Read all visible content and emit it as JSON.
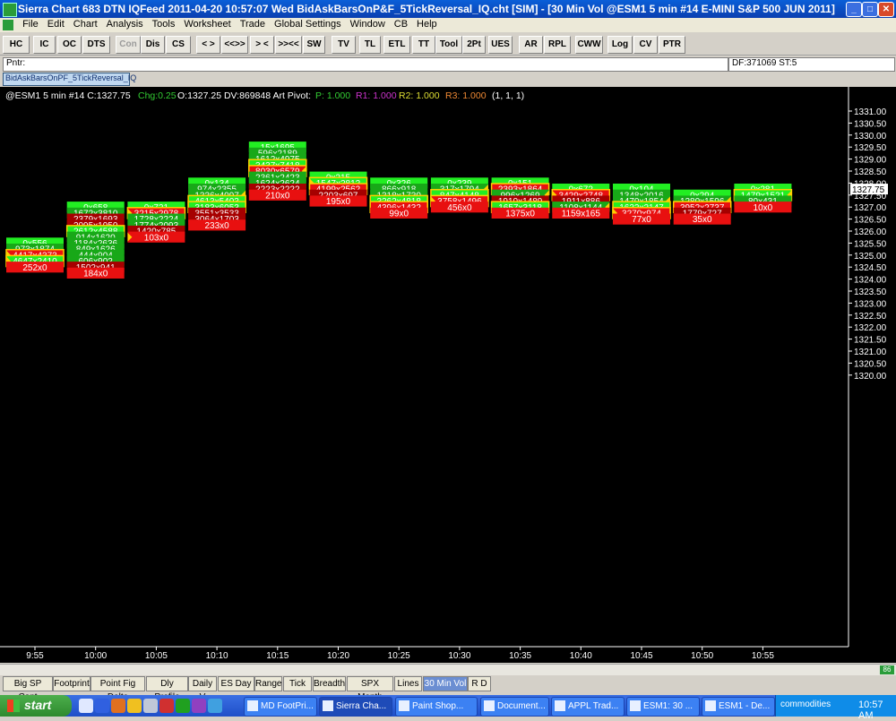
{
  "window": {
    "title": "Sierra Chart 683 DTN IQFeed 2011-04-20  10:57:07  Wed   BidAskBarsOnP&F_5TickReversal_IQ.cht [SIM] - [30 Min Vol  @ESM1  5 min   #14  E-MINI S&P 500 JUN 2011]"
  },
  "menu": [
    "File",
    "Edit",
    "Chart",
    "Analysis",
    "Tools",
    "Worksheet",
    "Trade",
    "Global Settings",
    "Window",
    "CB",
    "Help"
  ],
  "toolbar": [
    "HC",
    "IC",
    "OC",
    "DTS",
    "Con",
    "Dis",
    "CS",
    "< >",
    "<<>>",
    "> <",
    ">><<",
    "SW",
    "TV",
    "TL",
    "ETL",
    "TT",
    "Tool",
    "2Pt",
    "UES",
    "AR",
    "RPL",
    "CWW",
    "Log",
    "CV",
    "PTR"
  ],
  "pointer": {
    "label": "Pntr:",
    "df": "DF:371069  ST:5"
  },
  "study_name": "BidAskBarsOnPF_5TickReversal_IQ",
  "header": {
    "symbol": "@ESM1  5 min   #14 C:1327.75",
    "chg": "Chg:0.25",
    "info": "O:1327.25 DV:869848  Art Pivot:",
    "p": "P: 1.000",
    "r1": "R1: 1.000",
    "r2": "R2: 1.000",
    "r3": "R3: 1.000",
    "tail": "(1, 1, 1)"
  },
  "colors": {
    "green_bright": "#22ee22",
    "green": "#18a818",
    "red": "#e81010",
    "red_dark": "#a60000",
    "orange": "#ffa020",
    "chg": "#33cc33",
    "p": "#33cc33",
    "r1": "#cc33cc",
    "r2": "#dddd33",
    "r3": "#ee8833"
  },
  "chart_data": {
    "type": "table",
    "price_axis": {
      "min": 1320.0,
      "max": 1331.0,
      "step": 0.25,
      "labels_step": 0.5
    },
    "last_price": "1327.75",
    "time_labels": [
      "9:55",
      "10:00",
      "10:05",
      "10:10",
      "10:15",
      "10:20",
      "10:25",
      "10:30",
      "10:35",
      "10:40",
      "10:45",
      "10:50",
      "10:55"
    ],
    "bars": [
      {
        "time": "9:55",
        "top": 1325.5,
        "rows": [
          {
            "t": "0x556",
            "c": "gb"
          },
          {
            "t": "973x1874",
            "c": "g"
          },
          {
            "t": "4417x4373",
            "c": "ro",
            "m": "L"
          },
          {
            "t": "4647x2410",
            "c": "go",
            "m": "L"
          },
          {
            "t": "252x0",
            "c": "r"
          }
        ]
      },
      {
        "time": "10:00",
        "top": 1327.0,
        "rows": [
          {
            "t": "0x658",
            "c": "gb"
          },
          {
            "t": "1672x3810",
            "c": "g"
          },
          {
            "t": "2379x1693",
            "c": "rd"
          },
          {
            "t": "2095x1950",
            "c": "rd"
          },
          {
            "t": "2612x4588",
            "c": "go"
          },
          {
            "t": "914x1620",
            "c": "g"
          },
          {
            "t": "1184x2636",
            "c": "g"
          },
          {
            "t": "849x1626",
            "c": "g"
          },
          {
            "t": "444x904",
            "c": "g"
          },
          {
            "t": "606x902",
            "c": "g"
          },
          {
            "t": "1502x941",
            "c": "rd"
          },
          {
            "t": "184x0",
            "c": "r"
          }
        ]
      },
      {
        "time": "10:05",
        "top": 1327.0,
        "rows": [
          {
            "t": "0x721",
            "c": "gb"
          },
          {
            "t": "3215x2978",
            "c": "ro",
            "m": "L"
          },
          {
            "t": "1728x2224",
            "c": "g"
          },
          {
            "t": "1774x2093",
            "c": "g"
          },
          {
            "t": "1420x785",
            "c": "rd"
          },
          {
            "t": "103x0",
            "c": "r",
            "m": "L"
          }
        ]
      },
      {
        "time": "10:10",
        "top": 1328.0,
        "rows": [
          {
            "t": "0x134",
            "c": "gb"
          },
          {
            "t": "974x2355",
            "c": "g"
          },
          {
            "t": "1336x4097",
            "c": "g",
            "m": "R"
          },
          {
            "t": "4613x5403",
            "c": "go"
          },
          {
            "t": "3183x6053",
            "c": "go"
          },
          {
            "t": "3551x3533",
            "c": "rd"
          },
          {
            "t": "3064x1703",
            "c": "rd"
          },
          {
            "t": "233x0",
            "c": "r"
          }
        ]
      },
      {
        "time": "10:15",
        "top": 1329.5,
        "rows": [
          {
            "t": "15x1695",
            "c": "gb"
          },
          {
            "t": "596x2189",
            "c": "g"
          },
          {
            "t": "1612x4975",
            "c": "g"
          },
          {
            "t": "3437x7418",
            "c": "go"
          },
          {
            "t": "8030x6579",
            "c": "ro",
            "m": "R"
          },
          {
            "t": "2361x2423",
            "c": "g"
          },
          {
            "t": "1624x2624",
            "c": "g"
          },
          {
            "t": "2223x2222",
            "c": "rd"
          },
          {
            "t": "210x0",
            "c": "r"
          }
        ]
      },
      {
        "time": "10:20",
        "top": 1328.25,
        "rows": [
          {
            "t": "0x215",
            "c": "gb"
          },
          {
            "t": "1547x2812",
            "c": "go",
            "m": "L"
          },
          {
            "t": "4199x2562",
            "c": "ro"
          },
          {
            "t": "2203x697",
            "c": "rd"
          },
          {
            "t": "195x0",
            "c": "r"
          }
        ]
      },
      {
        "time": "10:25",
        "top": 1328.0,
        "rows": [
          {
            "t": "0x326",
            "c": "gb"
          },
          {
            "t": "866x918",
            "c": "g"
          },
          {
            "t": "1318x1730",
            "c": "g"
          },
          {
            "t": "3262x4818",
            "c": "go"
          },
          {
            "t": "4396x1432",
            "c": "ro"
          },
          {
            "t": "99x0",
            "c": "r"
          }
        ]
      },
      {
        "time": "10:30",
        "top": 1328.0,
        "rows": [
          {
            "t": "0x239",
            "c": "gb"
          },
          {
            "t": "317x1794",
            "c": "g",
            "m": "R"
          },
          {
            "t": "847x4148",
            "c": "go"
          },
          {
            "t": "3758x1496",
            "c": "ro",
            "m": "L"
          },
          {
            "t": "456x0",
            "c": "r"
          }
        ]
      },
      {
        "time": "10:35",
        "top": 1328.0,
        "rows": [
          {
            "t": "0x151",
            "c": "gb"
          },
          {
            "t": "2393x1864",
            "c": "ro"
          },
          {
            "t": "996x1269",
            "c": "g",
            "m": "R"
          },
          {
            "t": "1910x1489",
            "c": "rd"
          },
          {
            "t": "1657x3118",
            "c": "go"
          },
          {
            "t": "1375x0",
            "c": "r"
          }
        ]
      },
      {
        "time": "10:40",
        "top": 1327.75,
        "rows": [
          {
            "t": "0x672",
            "c": "gb"
          },
          {
            "t": "3429x2748",
            "c": "ro",
            "m": "L"
          },
          {
            "t": "1911x886",
            "c": "rd"
          },
          {
            "t": "1108x1144",
            "c": "g",
            "m": "R"
          },
          {
            "t": "1159x165",
            "c": "r"
          }
        ]
      },
      {
        "time": "10:45",
        "top": 1327.75,
        "rows": [
          {
            "t": "0x104",
            "c": "gb"
          },
          {
            "t": "1348x2016",
            "c": "g"
          },
          {
            "t": "1470x1854",
            "c": "g",
            "m": "R"
          },
          {
            "t": "1632x2147",
            "c": "go"
          },
          {
            "t": "3270x974",
            "c": "ro",
            "m": "L"
          },
          {
            "t": "77x0",
            "c": "r"
          }
        ]
      },
      {
        "time": "10:50",
        "top": 1327.5,
        "rows": [
          {
            "t": "0x294",
            "c": "gb"
          },
          {
            "t": "1280x1596",
            "c": "g",
            "m": "R"
          },
          {
            "t": "3952x2737",
            "c": "ro"
          },
          {
            "t": "1779x727",
            "c": "rd"
          },
          {
            "t": "35x0",
            "c": "r"
          }
        ]
      },
      {
        "time": "10:55",
        "top": 1327.75,
        "rows": [
          {
            "t": "0x281",
            "c": "gb"
          },
          {
            "t": "1479x1521",
            "c": "go",
            "m": "R"
          },
          {
            "t": "80x431",
            "c": "g"
          },
          {
            "t": "10x0",
            "c": "r"
          }
        ]
      }
    ]
  },
  "tabs": [
    "Big SP Cont",
    "Footprint",
    "Point Fig Delta",
    "Dly Profile",
    "Daily V",
    "ES Day",
    "Range",
    "Tick",
    "Breadth",
    "SPX Month",
    "Lines",
    "30 Min Vol",
    "R D"
  ],
  "active_tab": "30 Min Vol",
  "scroll_indicator": "86",
  "taskbar": {
    "start": "start",
    "tasks": [
      "MD FootPri...",
      "Sierra Cha...",
      "Paint Shop...",
      "Document...",
      "APPL Trad...",
      "ESM1: 30 ...",
      "ESM1 - De..."
    ],
    "tray": "commodities",
    "clock": "10:57 AM"
  }
}
